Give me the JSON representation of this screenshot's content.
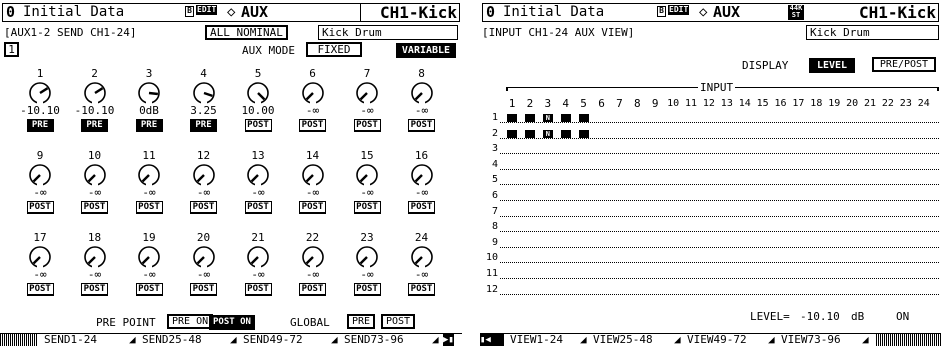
{
  "left": {
    "header": {
      "scene_number": "0",
      "scene_title": "Initial Data",
      "b_flag": "B",
      "edit_flag": "EDIT",
      "diamond": "◇",
      "mode": "AUX",
      "channel": "CH1-Kick"
    },
    "page_label": "AUX1-2 SEND CH1-24",
    "all_nominal_button": "ALL NOMINAL",
    "channel_name": "Kick Drum",
    "aux_number": "1",
    "aux_mode_label": "AUX MODE",
    "aux_mode_fixed": "FIXED",
    "aux_mode_variable": "VARIABLE",
    "channels": [
      {
        "no": "1",
        "value": "-10.10",
        "point": "PRE",
        "level": -10.1
      },
      {
        "no": "2",
        "value": "-10.10",
        "point": "PRE",
        "level": -10.1
      },
      {
        "no": "3",
        "value": "0dB",
        "point": "PRE",
        "level": 0
      },
      {
        "no": "4",
        "value": "3.25",
        "point": "PRE",
        "level": 3.25
      },
      {
        "no": "5",
        "value": "10.00",
        "point": "POST",
        "level": 10
      },
      {
        "no": "6",
        "value": "-∞",
        "point": "POST",
        "level": null
      },
      {
        "no": "7",
        "value": "-∞",
        "point": "POST",
        "level": null
      },
      {
        "no": "8",
        "value": "-∞",
        "point": "POST",
        "level": null
      },
      {
        "no": "9",
        "value": "-∞",
        "point": "POST",
        "level": null
      },
      {
        "no": "10",
        "value": "-∞",
        "point": "POST",
        "level": null
      },
      {
        "no": "11",
        "value": "-∞",
        "point": "POST",
        "level": null
      },
      {
        "no": "12",
        "value": "-∞",
        "point": "POST",
        "level": null
      },
      {
        "no": "13",
        "value": "-∞",
        "point": "POST",
        "level": null
      },
      {
        "no": "14",
        "value": "-∞",
        "point": "POST",
        "level": null
      },
      {
        "no": "15",
        "value": "-∞",
        "point": "POST",
        "level": null
      },
      {
        "no": "16",
        "value": "-∞",
        "point": "POST",
        "level": null
      },
      {
        "no": "17",
        "value": "-∞",
        "point": "POST",
        "level": null
      },
      {
        "no": "18",
        "value": "-∞",
        "point": "POST",
        "level": null
      },
      {
        "no": "19",
        "value": "-∞",
        "point": "POST",
        "level": null
      },
      {
        "no": "20",
        "value": "-∞",
        "point": "POST",
        "level": null
      },
      {
        "no": "21",
        "value": "-∞",
        "point": "POST",
        "level": null
      },
      {
        "no": "22",
        "value": "-∞",
        "point": "POST",
        "level": null
      },
      {
        "no": "23",
        "value": "-∞",
        "point": "POST",
        "level": null
      },
      {
        "no": "24",
        "value": "-∞",
        "point": "POST",
        "level": null
      }
    ],
    "pre_point_label": "PRE POINT",
    "pre_on": "PRE ON",
    "post_on": "POST ON",
    "global_label": "GLOBAL",
    "global_pre": "PRE",
    "global_post": "POST",
    "tabs": [
      "SEND1-24",
      "SEND25-48",
      "SEND49-72",
      "SEND73-96"
    ],
    "tab_selected": 0,
    "tab_scroll": "▶▮"
  },
  "right": {
    "header": {
      "scene_number": "0",
      "scene_title": "Initial Data",
      "b_flag": "B",
      "edit_flag": "EDIT",
      "diamond": "◇",
      "mode": "AUX",
      "st_top": "44K",
      "st_bottom": "ST",
      "channel": "CH1-Kick"
    },
    "page_label": "INPUT CH1-24 AUX VIEW",
    "channel_name": "Kick Drum",
    "display_label": "DISPLAY",
    "display_level": "LEVEL",
    "display_prepost": "PRE/POST",
    "input_label": "INPUT",
    "columns": [
      "1",
      "2",
      "3",
      "4",
      "5",
      "6",
      "7",
      "8",
      "9",
      "10",
      "11",
      "12",
      "13",
      "14",
      "15",
      "16",
      "17",
      "18",
      "19",
      "20",
      "21",
      "22",
      "23",
      "24"
    ],
    "rows": [
      {
        "no": "1",
        "cells": {
          "1": "█",
          "2": "█",
          "3": "N",
          "4": "█",
          "5": "█"
        }
      },
      {
        "no": "2",
        "cells": {
          "1": "█",
          "2": "█",
          "3": "N",
          "4": "█",
          "5": "█"
        }
      },
      {
        "no": "3",
        "cells": {}
      },
      {
        "no": "4",
        "cells": {}
      },
      {
        "no": "5",
        "cells": {}
      },
      {
        "no": "6",
        "cells": {}
      },
      {
        "no": "7",
        "cells": {}
      },
      {
        "no": "8",
        "cells": {}
      },
      {
        "no": "9",
        "cells": {}
      },
      {
        "no": "10",
        "cells": {}
      },
      {
        "no": "11",
        "cells": {}
      },
      {
        "no": "12",
        "cells": {}
      }
    ],
    "level_label": "LEVEL=",
    "level_value": "-10.10",
    "level_unit": "dB",
    "on_state": "ON",
    "tabs": [
      "VIEW1-24",
      "VIEW25-48",
      "VIEW49-72",
      "VIEW73-96"
    ],
    "tab_selected": 0,
    "tab_scroll": "▮◀"
  }
}
